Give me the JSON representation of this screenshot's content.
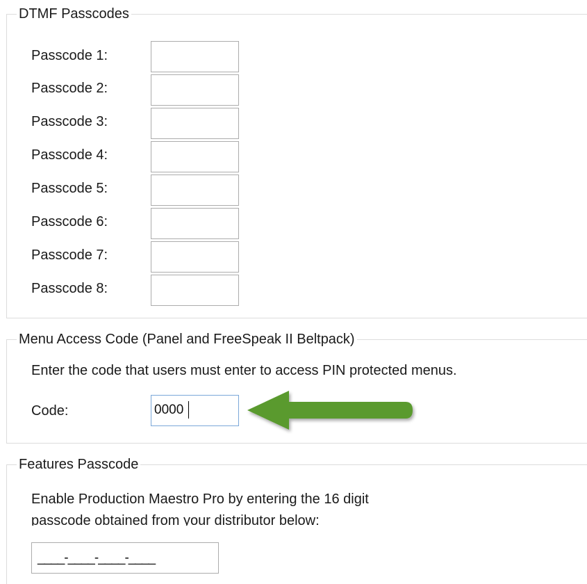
{
  "dtmf": {
    "legend": "DTMF Passcodes",
    "passcodes": [
      {
        "label": "Passcode 1:",
        "value": ""
      },
      {
        "label": "Passcode 2:",
        "value": ""
      },
      {
        "label": "Passcode 3:",
        "value": ""
      },
      {
        "label": "Passcode 4:",
        "value": ""
      },
      {
        "label": "Passcode 5:",
        "value": ""
      },
      {
        "label": "Passcode 6:",
        "value": ""
      },
      {
        "label": "Passcode 7:",
        "value": ""
      },
      {
        "label": "Passcode 8:",
        "value": ""
      }
    ]
  },
  "menu_access": {
    "legend": "Menu Access Code (Panel and FreeSpeak II Beltpack)",
    "description": "Enter the code that users must enter to access PIN protected menus.",
    "code_label": "Code:",
    "code_value": "0000",
    "arrow_color": "#5a9a2f",
    "arrow_icon": "arrow-left-icon"
  },
  "features": {
    "legend": "Features Passcode",
    "description_line1": "Enable Production Maestro Pro by entering the 16 digit",
    "description_line2": "passcode obtained from your distributor below:",
    "passcode_mask": "____-____-____-____"
  }
}
